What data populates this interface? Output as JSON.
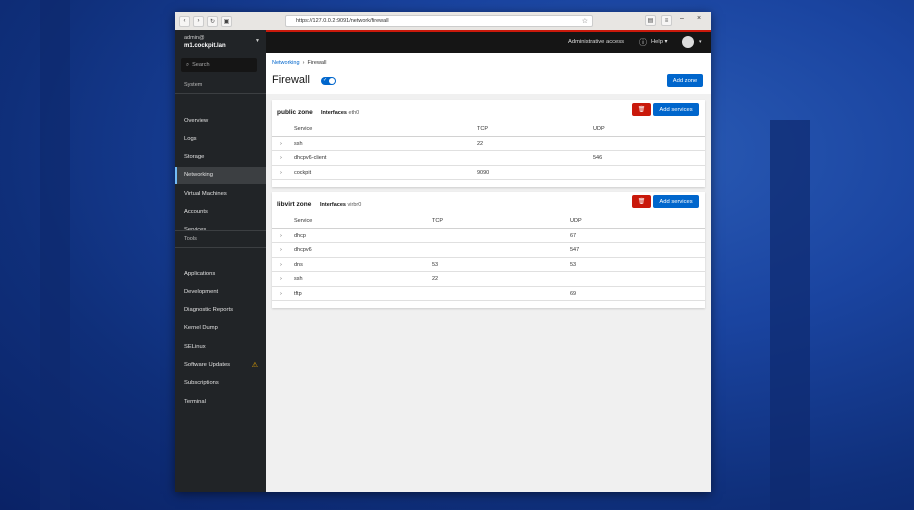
{
  "browser": {
    "url": "https://127.0.0.2:9091/network/firewall"
  },
  "sidebar": {
    "user": "admin@",
    "host": "m1.cockpit.lan",
    "search_placeholder": "Search",
    "system_label": "System",
    "tools_label": "Tools",
    "system_items": [
      {
        "label": "Overview"
      },
      {
        "label": "Logs"
      },
      {
        "label": "Storage"
      },
      {
        "label": "Networking",
        "selected": true
      },
      {
        "label": "Virtual Machines"
      },
      {
        "label": "Accounts"
      },
      {
        "label": "Services"
      }
    ],
    "tools_items": [
      {
        "label": "Applications"
      },
      {
        "label": "Development"
      },
      {
        "label": "Diagnostic Reports"
      },
      {
        "label": "Kernel Dump"
      },
      {
        "label": "SELinux"
      },
      {
        "label": "Software Updates",
        "warning": true
      },
      {
        "label": "Subscriptions"
      },
      {
        "label": "Terminal"
      }
    ]
  },
  "topbar": {
    "admin": "Administrative access",
    "help": "Help"
  },
  "page": {
    "breadcrumb_parent": "Networking",
    "breadcrumb_current": "Firewall",
    "title": "Firewall",
    "toggle_on": true,
    "add_zone": "Add zone"
  },
  "zones": [
    {
      "name": "public zone",
      "interfaces_label": "Interfaces",
      "interfaces": "eth0",
      "add_services": "Add services",
      "headers": [
        "Service",
        "TCP",
        "UDP"
      ],
      "rows": [
        [
          "ssh",
          "22",
          ""
        ],
        [
          "dhcpv6-client",
          "",
          "546"
        ],
        [
          "cockpit",
          "9090",
          ""
        ]
      ]
    },
    {
      "name": "libvirt zone",
      "interfaces_label": "Interfaces",
      "interfaces": "virbr0",
      "add_services": "Add services",
      "headers": [
        "Service",
        "TCP",
        "UDP"
      ],
      "rows": [
        [
          "dhcp",
          "",
          "67"
        ],
        [
          "dhcpv6",
          "",
          "547"
        ],
        [
          "dns",
          "53",
          "53"
        ],
        [
          "ssh",
          "22",
          ""
        ],
        [
          "tftp",
          "",
          "69"
        ]
      ]
    }
  ],
  "colors": {
    "accent": "#0066cc",
    "danger": "#c9190b",
    "warning": "#f0ab00"
  }
}
